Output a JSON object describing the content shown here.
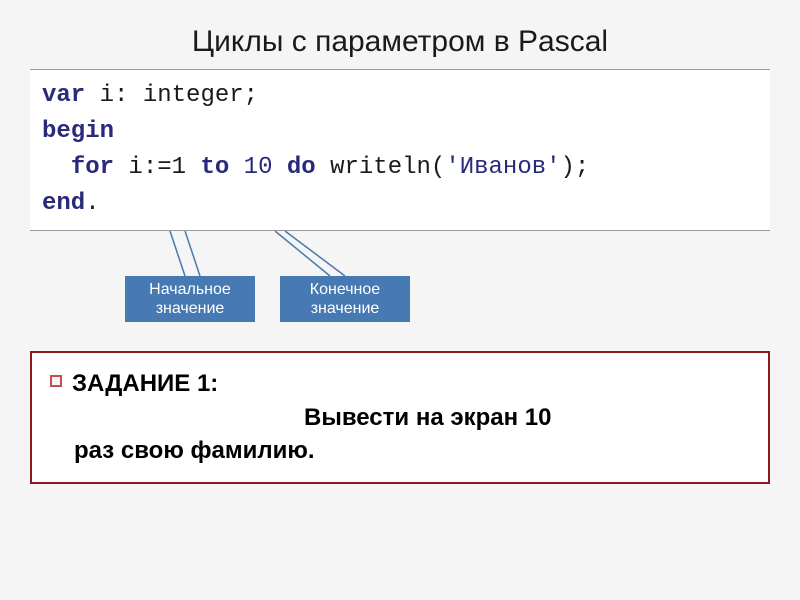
{
  "title": "Циклы с параметром в Pascal",
  "code": {
    "line1_kw": "var",
    "line1_rest": " i: integer;",
    "line2_kw": "begin",
    "line3_indent": "  ",
    "line3_for": "for",
    "line3_assign": " i:=1 ",
    "line3_to": "to",
    "line3_end_val": " 10 ",
    "line3_do": "do",
    "line3_writeln": " writeln(",
    "line3_str": "'Иванов'",
    "line3_close": ");",
    "line4_kw": "end",
    "line4_rest": "."
  },
  "callouts": {
    "start_label_1": "Начальное",
    "start_label_2": "значение",
    "end_label_1": "Конечное",
    "end_label_2": "значение"
  },
  "task": {
    "label": " ЗАДАНИЕ 1:",
    "text_line1": "Вывести на экран 10",
    "text_line2": "раз свою фамилию."
  }
}
